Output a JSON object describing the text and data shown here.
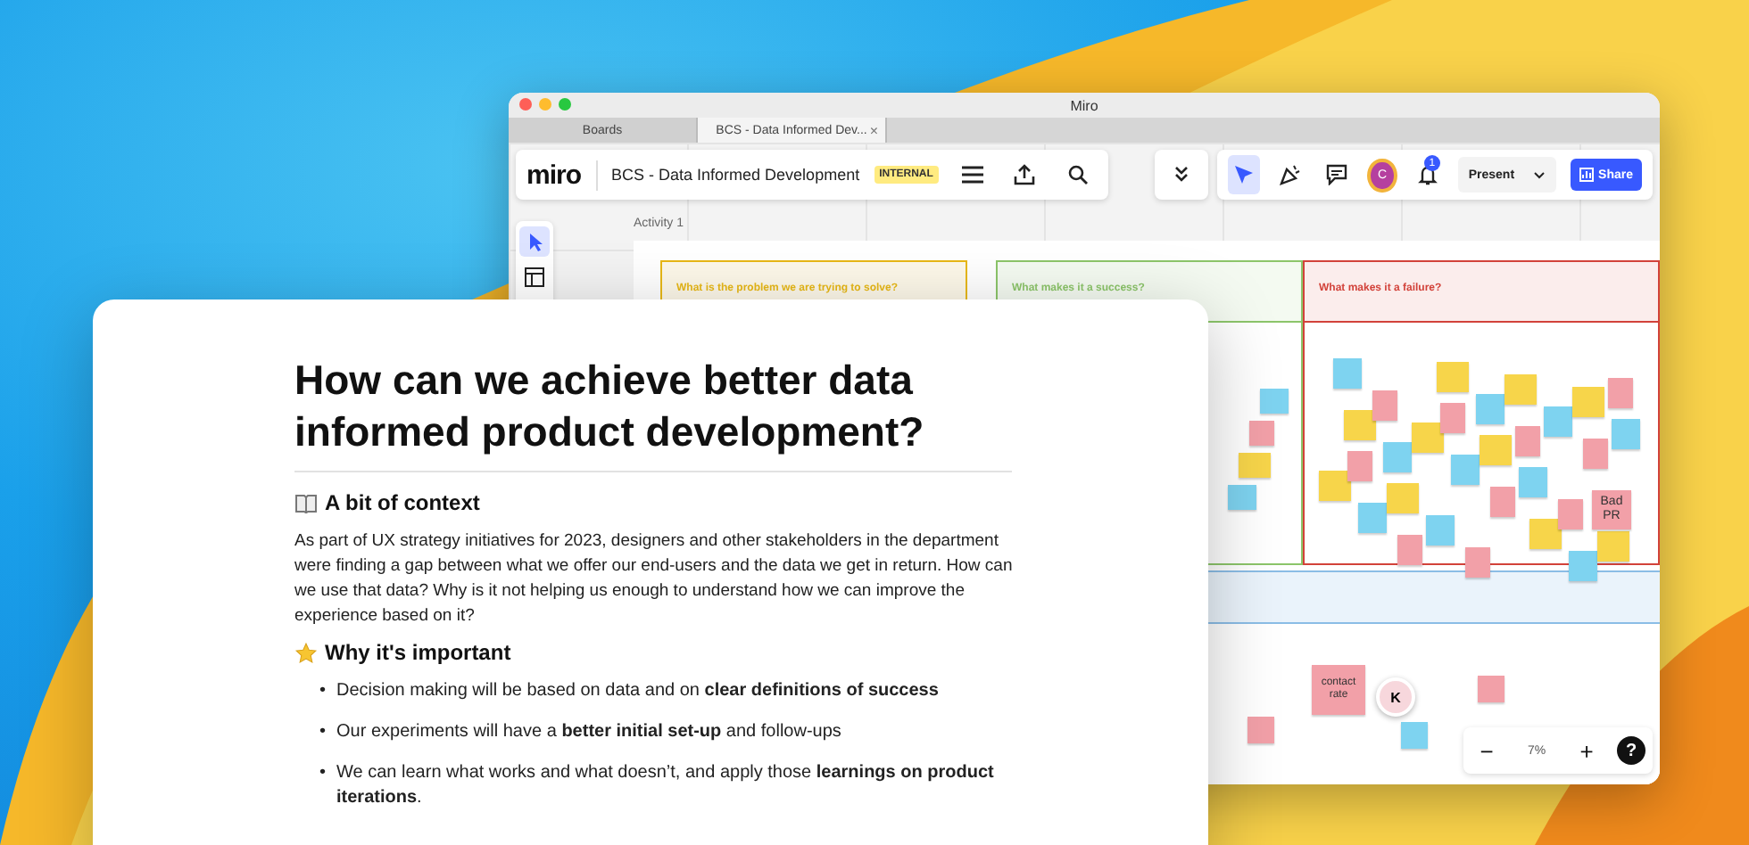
{
  "window": {
    "title": "Miro"
  },
  "tabs": [
    {
      "label": "Boards",
      "selected": false
    },
    {
      "label": "BCS - Data Informed Dev...",
      "selected": true,
      "close": "×"
    }
  ],
  "toolbar": {
    "logo": "miro",
    "board_title": "BCS - Data Informed Development",
    "badge": "INTERNAL",
    "avatar": "C",
    "notification_count": "1",
    "present": "Present",
    "share": "Share"
  },
  "canvas": {
    "frame_title": "Activity 1",
    "columns": [
      {
        "title": "What is the problem we are trying to solve?",
        "color": "#e8b816"
      },
      {
        "title": "What makes it a success?",
        "color": "#8cc56a"
      },
      {
        "title": "What makes it a failure?",
        "color": "#d2423a"
      }
    ],
    "stickies": [
      {
        "text": "Bad PR"
      },
      {
        "text": "contact rate"
      }
    ],
    "cursor_avatar": "K",
    "zoom_out": "−",
    "zoom": "7%",
    "zoom_in": "+",
    "help": "?"
  },
  "document": {
    "title": "How can we achieve better data informed product development?",
    "sections": [
      {
        "kind": "paragraph",
        "heading": "A bit of context",
        "text": "As part of UX strategy initiatives for 2023, designers and other stakeholders in the department were finding a gap between what we offer our end-users and the data we get in return. How can we use that data? Why is it not helping us enough to understand how we can improve the experience based on it?"
      },
      {
        "kind": "bullets",
        "heading": "Why it's important",
        "bullet": "•",
        "items": [
          "Decision making will be based on data and on **clear definitions of success**",
          "Our experiments will have a **better initial set-up** and follow-ups",
          "We can learn what works and what doesn’t, and apply those **learnings on product iterations**."
        ]
      }
    ]
  }
}
